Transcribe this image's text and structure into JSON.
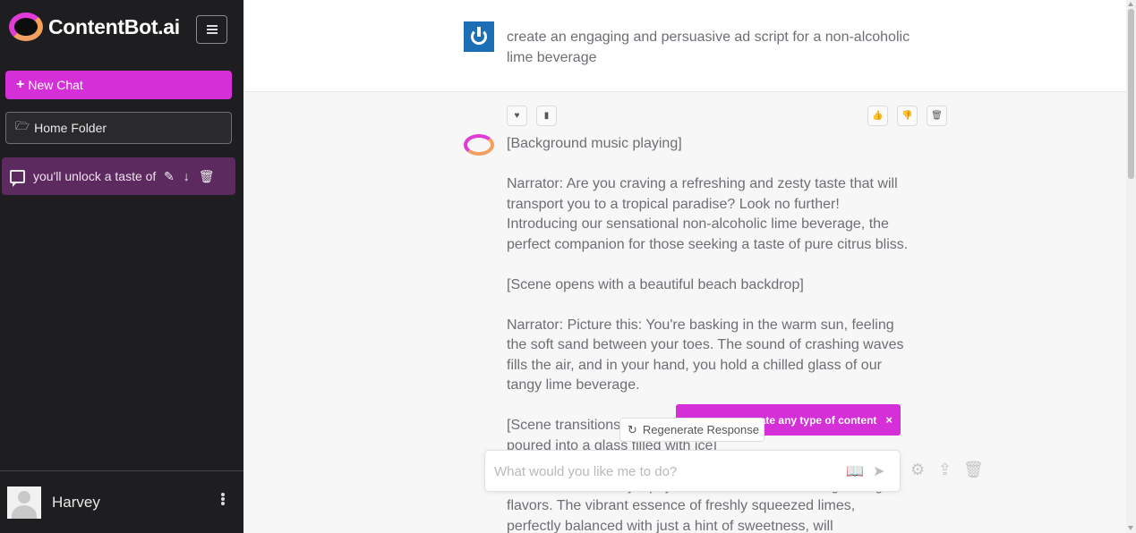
{
  "sidebar": {
    "logo_text": "ContentBot.ai",
    "new_chat_label": "New Chat",
    "home_folder_label": "Home Folder",
    "chat_item_label": "you'll unlock a taste of",
    "user_name": "Harvey"
  },
  "conversation": {
    "user_prompt": "create an engaging and persuasive ad script for a non-alcoholic lime beverage",
    "response": {
      "p1": "[Background music playing]",
      "p2": "Narrator: Are you craving a refreshing and zesty taste that will transport you to a tropical paradise? Look no further! Introducing our sensational non-alcoholic lime beverage, the perfect companion for those seeking a taste of pure citrus bliss.",
      "p3": "[Scene opens with a beautiful beach backdrop]",
      "p4": "Narrator: Picture this: You're basking in the warm sun, feeling the soft sand between your toes. The sound of crashing waves fills the air, and in your hand, you hold a chilled glass of our tangy lime beverage.",
      "p5": "[Scene transitions to a close-up of the lime beverage being poured into a glass filled with ice]",
      "p6": "Narrator: With every sip, you'll unlock a taste of invigorating flavors. The vibrant essence of freshly squeezed limes, perfectly balanced with just a hint of sweetness, will"
    }
  },
  "tooltip": {
    "text": "ate any type of content",
    "close": "×"
  },
  "regenerate_label": "Regenerate Response",
  "input": {
    "placeholder": "What would you like me to do?"
  },
  "icons": {
    "favorite": "heart-icon",
    "copy": "clipboard-icon",
    "thumbs_up": "thumbs-up-icon",
    "thumbs_down": "thumbs-down-icon",
    "delete": "trash-icon",
    "settings": "gear-icon",
    "upload": "upload-icon",
    "prompt_library": "book-icon",
    "send": "send-icon"
  },
  "colors": {
    "brand": "#d52fd8",
    "sidebar_bg": "#1e1e20",
    "active_chat_bg": "#5c2a5e",
    "user_avatar": "#1c6fb4"
  }
}
